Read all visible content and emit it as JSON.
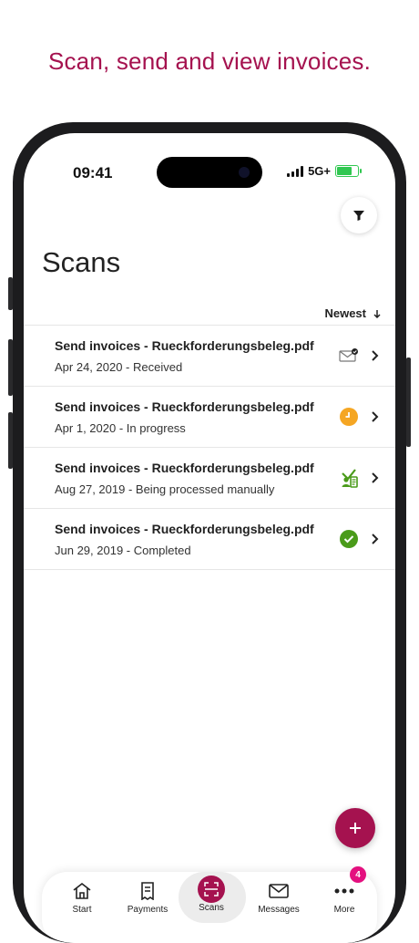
{
  "headline": "Scan, send and view invoices.",
  "status": {
    "time": "09:41",
    "network": "5G+"
  },
  "page": {
    "title": "Scans"
  },
  "sort": {
    "label": "Newest"
  },
  "rows": [
    {
      "title": "Send invoices - Rueckforderungsbeleg.pdf",
      "subtitle": "Apr 24, 2020 - Received",
      "icon": "envelope-check-icon"
    },
    {
      "title": "Send invoices - Rueckforderungsbeleg.pdf",
      "subtitle": "Apr 1, 2020 - In progress",
      "icon": "clock-icon"
    },
    {
      "title": "Send invoices - Rueckforderungsbeleg.pdf",
      "subtitle": "Aug 27, 2019 - Being processed manually",
      "icon": "document-person-icon"
    },
    {
      "title": "Send invoices - Rueckforderungsbeleg.pdf",
      "subtitle": "Jun 29, 2019 - Completed",
      "icon": "check-circle-icon"
    }
  ],
  "nav": [
    {
      "label": "Start",
      "icon": "home-icon"
    },
    {
      "label": "Payments",
      "icon": "receipt-icon"
    },
    {
      "label": "Scans",
      "icon": "scan-icon"
    },
    {
      "label": "Messages",
      "icon": "envelope-icon"
    },
    {
      "label": "More",
      "icon": "more-dots-icon",
      "badge": "4"
    }
  ],
  "colors": {
    "accent": "#a5124f",
    "badge": "#e4107f",
    "inprogress": "#f5a623",
    "completed": "#4a9b1a",
    "battery": "#31c751"
  }
}
